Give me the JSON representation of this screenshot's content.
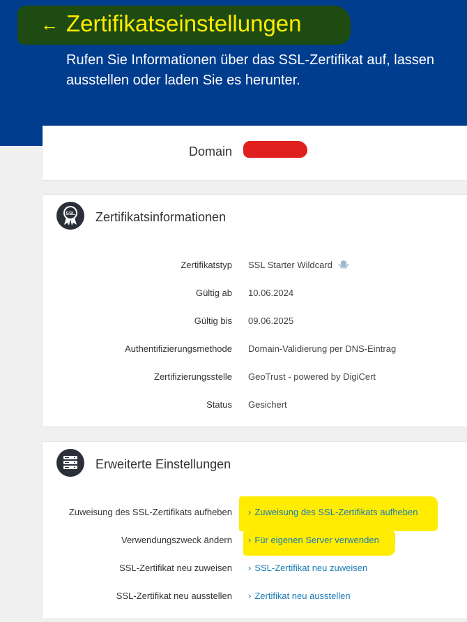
{
  "header": {
    "title": "Zertifikatseinstellungen",
    "subtitle_line1": "Rufen Sie Informationen über das SSL-Zertifikat auf, lassen",
    "subtitle_line2": "ausstellen oder laden Sie es herunter.",
    "back_icon": "arrow-left-icon",
    "colors": {
      "background": "#003d8f",
      "title": "#ffec00"
    }
  },
  "domain_card": {
    "label": "Domain"
  },
  "info_card": {
    "heading": "Zertifikatsinformationen",
    "icon": "ssl-badge-icon",
    "rows": [
      {
        "label": "Zertifikatstyp",
        "value": "SSL Starter Wildcard"
      },
      {
        "label": "Gültig ab",
        "value": "10.06.2024"
      },
      {
        "label": "Gültig bis",
        "value": "09.06.2025"
      },
      {
        "label": "Authentifizierungsmethode",
        "value": "Domain-Validierung per DNS-Eintrag"
      },
      {
        "label": "Zertifizierungsstelle",
        "value": "GeoTrust - powered by DigiCert"
      },
      {
        "label": "Status",
        "value": "Gesichert"
      }
    ]
  },
  "advanced_card": {
    "heading": "Erweiterte Einstellungen",
    "icon": "server-icon",
    "rows": [
      {
        "label": "Zuweisung des SSL-Zertifikats aufheben",
        "link": "Zuweisung des SSL-Zertifikats aufheben"
      },
      {
        "label": "Verwendungszweck ändern",
        "link": "Für eigenen Server verwenden"
      },
      {
        "label": "SSL-Zertifikat neu zuweisen",
        "link": "SSL-Zertifikat neu zuweisen"
      },
      {
        "label": "SSL-Zertifikat neu ausstellen",
        "link": "Zertifikat neu ausstellen"
      }
    ],
    "link_color": "#1a7bb5",
    "highlight_color": "#ffec00"
  }
}
